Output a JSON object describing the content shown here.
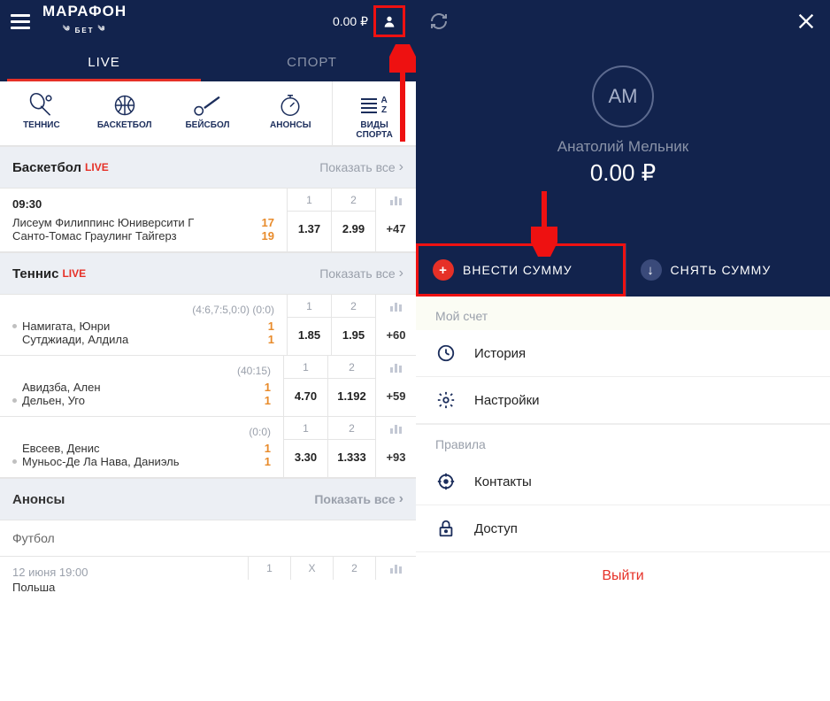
{
  "header": {
    "brand_main": "МАРАФОН",
    "brand_sub": "БЕТ",
    "balance": "0.00 ₽"
  },
  "tabs": {
    "live": "LIVE",
    "sport": "СПОРТ"
  },
  "sports_nav": {
    "tennis": "ТЕННИС",
    "basketball": "БАСКЕТБОЛ",
    "baseball": "БЕЙСБОЛ",
    "anons": "АНОНСЫ",
    "all_sports1": "ВИДЫ",
    "all_sports2": "СПОРТА"
  },
  "show_all": "Показать все",
  "live_label": "LIVE",
  "sections": {
    "basketball": "Баскетбол",
    "tennis": "Теннис",
    "anons": "Анонсы"
  },
  "odds_headers": {
    "one": "1",
    "two": "2",
    "x": "X"
  },
  "basketball_match": {
    "time": "09:30",
    "team1": "Лисеум Филиппинс Юниверсити Г",
    "team2": "Санто-Томас Граулинг Тайгерз",
    "score1": "17",
    "score2": "19",
    "odd1": "1.37",
    "odd2": "2.99",
    "more": "+47"
  },
  "tennis_matches": [
    {
      "set_score": "(4:6,7:5,0:0) (0:0)",
      "team1": "Намигата, Юнри",
      "team2": "Сутджиади, Алдила",
      "pts1": "1",
      "pts2": "1",
      "odd1": "1.85",
      "odd2": "1.95",
      "more": "+60"
    },
    {
      "set_score": "(40:15)",
      "team1": "Авидзба, Ален",
      "team2": "Дельен, Уго",
      "pts1": "1",
      "pts2": "1",
      "odd1": "4.70",
      "odd2": "1.192",
      "more": "+59"
    },
    {
      "set_score": "(0:0)",
      "team1": "Евсеев, Денис",
      "team2": "Муньос-Де Ла Нава, Даниэль",
      "pts1": "1",
      "pts2": "1",
      "odd1": "3.30",
      "odd2": "1.333",
      "more": "+93"
    }
  ],
  "football_label": "Футбол",
  "upcoming": {
    "date": "12 июня 19:00",
    "team": "Польша"
  },
  "account": {
    "initials": "АМ",
    "name": "Анатолий Мельник",
    "balance": "0.00 ₽",
    "deposit": "ВНЕСТИ СУММУ",
    "withdraw": "СНЯТЬ СУММУ",
    "section_account": "Мой счет",
    "history": "История",
    "settings": "Настройки",
    "section_rules": "Правила",
    "contacts": "Контакты",
    "access": "Доступ",
    "logout": "Выйти"
  }
}
